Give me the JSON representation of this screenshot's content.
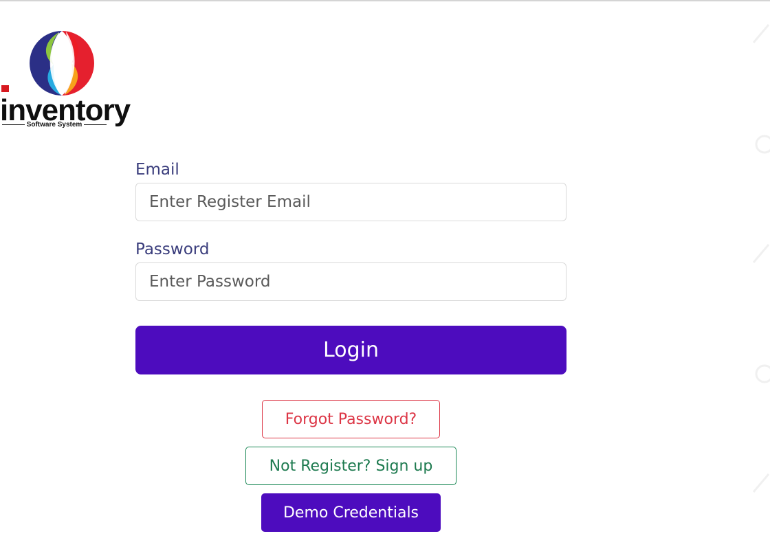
{
  "logo": {
    "word": "inventory",
    "subtitle": "Software System"
  },
  "form": {
    "email_label": "Email",
    "email_placeholder": "Enter Register Email",
    "password_label": "Password",
    "password_placeholder": "Enter Password",
    "login_label": "Login"
  },
  "links": {
    "forgot_label": "Forgot Password?",
    "signup_label": "Not Register? Sign up",
    "demo_label": "Demo Credentials"
  },
  "colors": {
    "primary": "#4d0cbe",
    "danger": "#dc3545",
    "success": "#198754",
    "label": "#3a3d7c"
  }
}
